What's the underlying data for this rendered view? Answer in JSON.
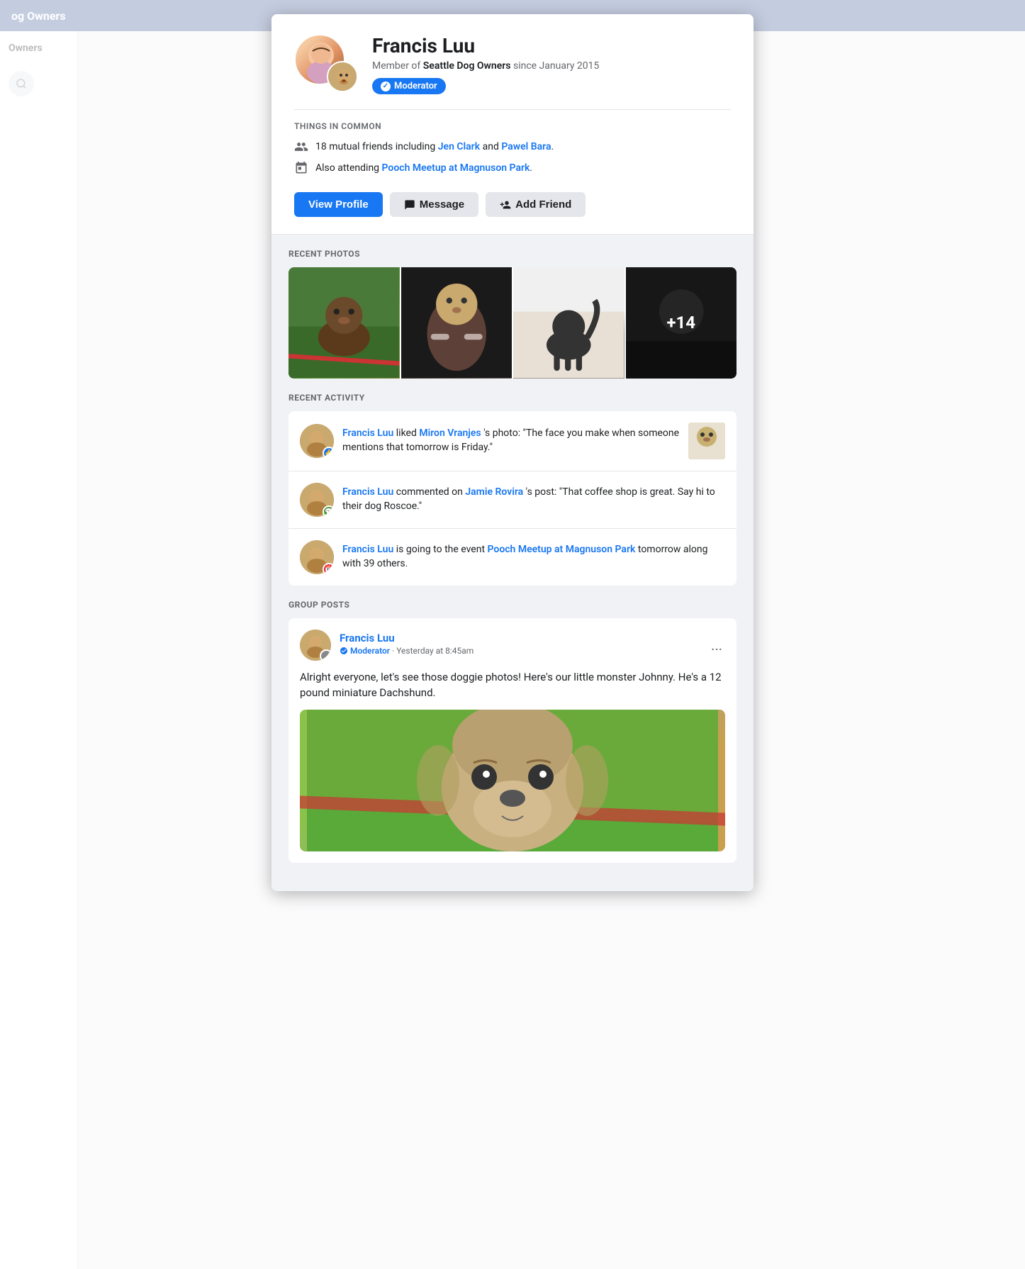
{
  "meta": {
    "title": "Seattle Dog Owners"
  },
  "topbar": {
    "title": "og Owners"
  },
  "sidebar": {
    "title": "Owners"
  },
  "modal": {
    "profile": {
      "name": "Francis Luu",
      "member_since": "Member of",
      "group_name": "Seattle Dog Owners",
      "since": "since January 2015",
      "badge_label": "Moderator"
    },
    "things_in_common": {
      "section_label": "THINGS IN COMMON",
      "mutual_friends_text": "18 mutual friends including",
      "friend1": "Jen Clark",
      "and_text": "and",
      "friend2": "Pawel Bara",
      "period": ".",
      "event_prefix": "Also attending",
      "event_name": "Pooch Meetup at Magnuson Park",
      "event_suffix": "."
    },
    "buttons": {
      "view_profile": "View Profile",
      "message": "Message",
      "add_friend": "Add Friend"
    },
    "recent_photos": {
      "section_label": "RECENT PHOTOS",
      "more_count": "+14"
    },
    "recent_activity": {
      "section_label": "RECENT ACTIVITY",
      "items": [
        {
          "actor": "Francis Luu",
          "action": "liked",
          "subject_person": "Miron Vranjes",
          "action2": "'s photo: \"The face you make when someone mentions that tomorrow is Friday.\"",
          "badge_type": "like"
        },
        {
          "actor": "Francis Luu",
          "action": "commented on",
          "subject_person": "Jamie Rovira",
          "action2": "'s post: \"That coffee shop is great. Say hi to their dog Roscoe.\"",
          "badge_type": "comment"
        },
        {
          "actor": "Francis Luu",
          "action": "is going to the event",
          "event_link": "Pooch Meetup at Magnuson Park",
          "action2": "tomorrow along with 39 others.",
          "badge_type": "event"
        }
      ]
    },
    "group_posts": {
      "section_label": "GROUP POSTS",
      "post": {
        "author": "Francis Luu",
        "badge": "Moderator",
        "time": "Yesterday at 8:45am",
        "content": "Alright everyone, let's see those doggie photos! Here's our little monster Johnny. He's a 12 pound miniature Dachshund.",
        "more_options": "..."
      }
    }
  }
}
